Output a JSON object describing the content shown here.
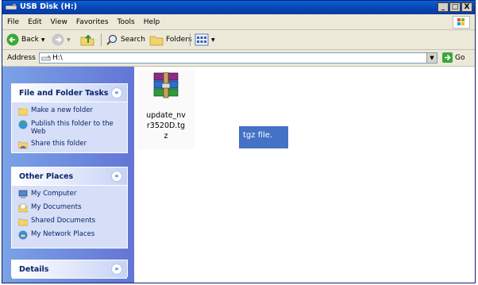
{
  "window": {
    "title": "USB Disk (H:)"
  },
  "title_controls": [
    "_",
    "□",
    "X"
  ],
  "menu": [
    "File",
    "Edit",
    "View",
    "Favorites",
    "Tools",
    "Help"
  ],
  "toolbar": {
    "back": "Back",
    "search": "Search",
    "folders": "Folders"
  },
  "address": {
    "label": "Address",
    "value": "H:\\",
    "go": "Go"
  },
  "tasks_panel": {
    "title": "File and Folder Tasks",
    "items": [
      "Make a new folder",
      "Publish this folder to the Web",
      "Share this folder"
    ]
  },
  "places_panel": {
    "title": "Other Places",
    "items": [
      "My Computer",
      "My Documents",
      "Shared Documents",
      "My Network Places"
    ]
  },
  "details_panel": {
    "title": "Details"
  },
  "file": {
    "name_line1": "update_nv",
    "name_line2": "r3520D.tg",
    "name_line3": "z",
    "icon": "winrar-archive-icon"
  },
  "annotation": {
    "text": "tgz file."
  },
  "colors": {
    "titlebar": "#0a50c8",
    "pane": "#7ba2e7",
    "annotation": "#4472c4"
  }
}
